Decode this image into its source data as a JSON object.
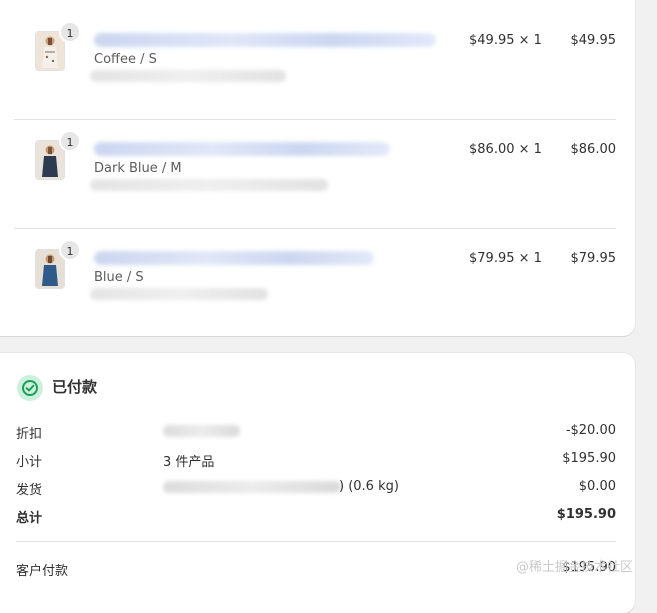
{
  "items": [
    {
      "quantity_badge": "1",
      "variant": "Coffee / S",
      "price_qty": "$49.95 × 1",
      "line_total": "$49.95"
    },
    {
      "quantity_badge": "1",
      "variant": "Dark Blue / M",
      "price_qty": "$86.00 × 1",
      "line_total": "$86.00"
    },
    {
      "quantity_badge": "1",
      "variant": "Blue / S",
      "price_qty": "$79.95 × 1",
      "line_total": "$79.95"
    }
  ],
  "payment": {
    "status_title": "已付款",
    "status_icon": "check-circle-icon",
    "accent_color": "#1a9e5a",
    "discount_label": "折扣",
    "discount_value": "-$20.00",
    "subtotal_label": "小计",
    "subtotal_items": "3 件产品",
    "subtotal_value": "$195.90",
    "shipping_label": "发货",
    "shipping_weight": ") (0.6 kg)",
    "shipping_value": "$0.00",
    "total_label": "总计",
    "total_value": "$195.90",
    "paid_by_customer_label": "客户付款",
    "paid_by_customer_value": "$195.90"
  },
  "watermark": "@稀土掘金技术社区"
}
